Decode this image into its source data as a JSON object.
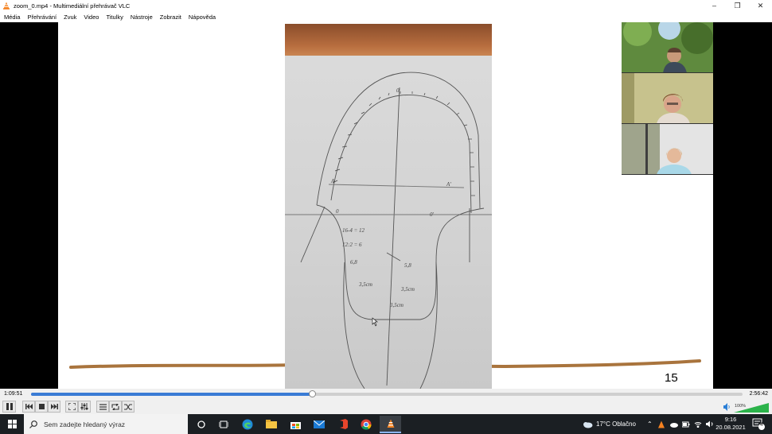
{
  "window": {
    "title": "zoom_0.mp4 - Multimediální přehrávač VLC",
    "minimize_icon": "minimize-icon",
    "maximize_icon": "restore-icon",
    "close_icon": "close-icon"
  },
  "menu": {
    "items": [
      "Média",
      "Přehrávání",
      "Zvuk",
      "Video",
      "Titulky",
      "Nástroje",
      "Zobrazit",
      "Nápověda"
    ]
  },
  "video": {
    "slide_number": "15",
    "sketch_texts": [
      "0",
      "A",
      "A'",
      "0",
      "0'",
      "16-4 = 12",
      "12:2 = 6",
      "6,8",
      "5,8",
      "3,5cm",
      "3,5cm",
      "3,5cm"
    ],
    "participants": [
      "participant-1",
      "participant-2",
      "participant-3"
    ]
  },
  "player": {
    "elapsed": "1:09:51",
    "total": "2:56:42",
    "progress": 0.395,
    "volume_label": "100%",
    "volume": 1.0,
    "accent": "#3a7bd5"
  },
  "taskbar": {
    "search_placeholder": "Sem zadejte hledaný výraz",
    "weather": "17°C  Oblačno",
    "time": "9:16",
    "date": "20.08.2021",
    "notification_count": "4"
  }
}
